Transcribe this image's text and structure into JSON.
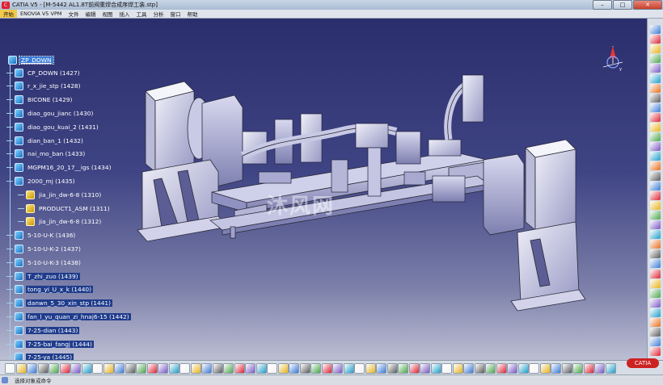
{
  "window": {
    "title": "CATIA V5 - [M-5442 AL1.8T前阀重焊合成序焊工装.stp]",
    "app_icon": "catia-icon",
    "min": "–",
    "max": "□",
    "close": "✕"
  },
  "menu": [
    "开始",
    "ENOVIA V5 VPM",
    "文件",
    "编辑",
    "视图",
    "插入",
    "工具",
    "分析",
    "窗口",
    "帮助"
  ],
  "tree": {
    "root": "ZP_DOWN",
    "nodes": [
      {
        "label": "CP_DOWN (1427)",
        "hl": false,
        "sub": false
      },
      {
        "label": "r_x_jie_stp (1428)",
        "hl": false,
        "sub": false
      },
      {
        "label": "BICONE (1429)",
        "hl": false,
        "sub": false
      },
      {
        "label": "diao_gou_jianc (1430)",
        "hl": false,
        "sub": false
      },
      {
        "label": "diao_gou_kuai_2 (1431)",
        "hl": false,
        "sub": false
      },
      {
        "label": "dian_ban_1 (1432)",
        "hl": false,
        "sub": false
      },
      {
        "label": "nai_mo_ban (1433)",
        "hl": false,
        "sub": false
      },
      {
        "label": "MGPM16_20_17__igs (1434)",
        "hl": false,
        "sub": false
      },
      {
        "label": "2000_mj (1435)",
        "hl": false,
        "sub": false
      },
      {
        "label": "jia_jin_dw-6-8 (1310)",
        "hl": false,
        "sub": true
      },
      {
        "label": "PRODUCT1_ASM (1311)",
        "hl": false,
        "sub": true
      },
      {
        "label": "jia_jin_dw-6-8 (1312)",
        "hl": false,
        "sub": true
      },
      {
        "label": "5-10-U-K (1436)",
        "hl": false,
        "sub": false
      },
      {
        "label": "5-10-U-K-2 (1437)",
        "hl": false,
        "sub": false
      },
      {
        "label": "5-10-U-K-3 (1438)",
        "hl": false,
        "sub": false
      },
      {
        "label": "T_zhi_zuo (1439)",
        "hl": true,
        "sub": false
      },
      {
        "label": "tong_yi_U_x_k (1440)",
        "hl": true,
        "sub": false
      },
      {
        "label": "danwn_5_30_xin_stp (1441)",
        "hl": true,
        "sub": false
      },
      {
        "label": "fan_l_yu_quan_zi_hnaj6-15 (1442)",
        "hl": true,
        "sub": false
      },
      {
        "label": "7-25-dian (1443)",
        "hl": true,
        "sub": false
      },
      {
        "label": "7-25-bai_fangj (1444)",
        "hl": true,
        "sub": false
      },
      {
        "label": "7-25-ya (1445)",
        "hl": true,
        "sub": false
      }
    ]
  },
  "watermark": "沐风网",
  "logo": "CATIA",
  "status": "选择对象或命令",
  "colors": {
    "viewport_top": "#2b2e6c",
    "viewport_bottom": "#bcbed3",
    "toolbar": "#d7dde6",
    "tree_text": "#ffffff",
    "selection": "#3b7ed8"
  }
}
